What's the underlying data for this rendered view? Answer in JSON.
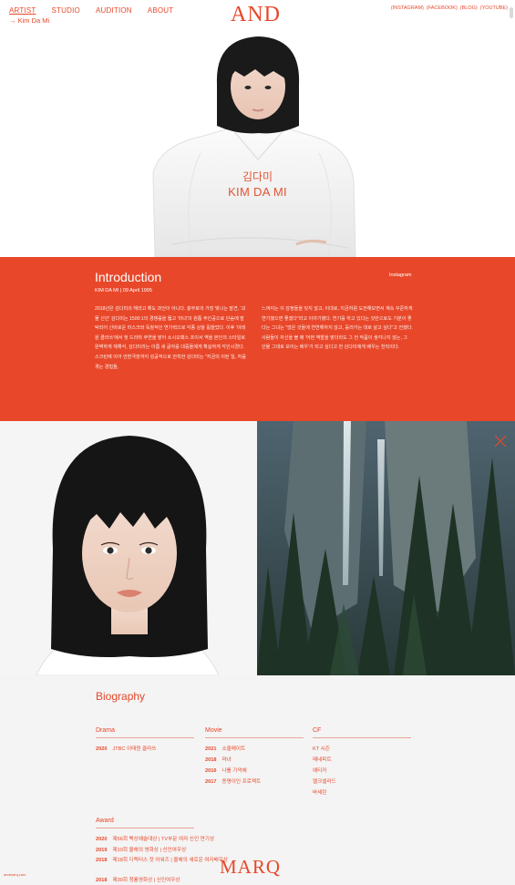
{
  "nav": {
    "items": [
      "ARTIST",
      "STUDIO",
      "AUDITION",
      "ABOUT"
    ],
    "breadcrumb": "→ Kim Da Mi",
    "logo": "AND",
    "social": [
      "(INSTAGRAM)",
      "(FACEBOOK)",
      "(BLOG)",
      "(YOUTUBE)"
    ]
  },
  "hero": {
    "name_ko": "김다미",
    "name_en": "KIM DA MI"
  },
  "intro": {
    "title": "Introduction",
    "meta": "KIM DA MI  |  09 April 1995",
    "instagram": "Instagram",
    "col1": "2018년은 김다미의 해라고 해도 과언이 아니다. 충무로의 가장 빛나는 발견, '괴물 신인' 김다미는 1500:1의 경쟁률을 뚫고 '마녀'의 원톱 주인공으로 단숨에 발탁되어 신비로운 마스크와 독창적인 연기력으로 각종 상을 휩쓸었다. 이후 '이태원 클라쓰'에서 첫 드라마 주연을 맡아 소시오패스 조이서 역을 본인의 스타일로 완벽하게 재해석, 김다미라는 이름 세 글자를 대중들에게 확실하게 각인시켰다. 스크린에 이어 안방극장까지 성공적으로 안착한 김다미는 \"지금의 이런 일, 처음 겪는 경험들,",
    "col2": "느껴지는 이 감정들을 잊지 않고, 이대로, 지금처럼 도전해보면서 계속 꾸준하게 연기했으면 좋겠다\"라고 이야기했다. 연기를 하고 있다는 것만으로도 기분이 좋다는 그녀는 \"많은 것들에 연연해하지 않고, 흘러가는 대로 살고 싶다\"고 전했다. 사람들이 자신을 볼 때 '어떤 역할을 맡더라도 그 전 작품이 생각나지 않는, 그 인물 그대로 보이는 배우'가 되고 싶다고 한 김다미에게 배우는 천직이다."
  },
  "bio": {
    "title": "Biography",
    "drama": {
      "heading": "Drama",
      "rows": [
        {
          "year": "2020",
          "text": "JTBC 이태원 클라쓰"
        }
      ]
    },
    "movie": {
      "heading": "Movie",
      "rows": [
        {
          "year": "2021",
          "text": "소울메이트"
        },
        {
          "year": "2018",
          "text": "마녀"
        },
        {
          "year": "2016",
          "text": "나를 기억해"
        },
        {
          "year": "2017",
          "text": "동명이인 프로젝트"
        }
      ]
    },
    "cf": {
      "heading": "CF",
      "rows": [
        "KT 시즌",
        "메네피트",
        "에티카",
        "멜크셀러드",
        "바세린"
      ]
    },
    "award": {
      "heading": "Award",
      "rows": [
        {
          "year": "2020",
          "text": "제56회 백상예술대상 | TV부문 여자 신인 연기상"
        },
        {
          "year": "2019",
          "text": "제10회 올해의 영화상 | 신인여우상"
        },
        {
          "year": "2018",
          "text": "제18회 디렉터스 컷 어워즈 | 올해의 새로운 여자배우상"
        },
        {
          "year": "2018",
          "text": "제39회 청룡영화상 | 신인여우상"
        }
      ]
    },
    "footer_small": "andmarq.com",
    "marq": "MARQ"
  },
  "colors": {
    "accent": "#e8472a",
    "background": "#f3f3f3",
    "white": "#ffffff"
  }
}
